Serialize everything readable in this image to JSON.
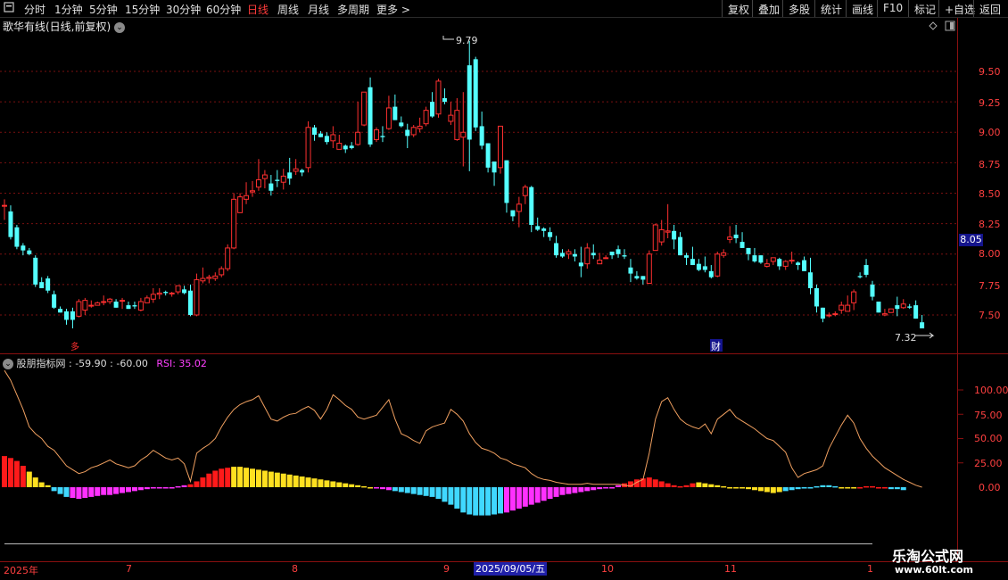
{
  "toolbar": {
    "left_items": [
      "分时",
      "1分钟",
      "5分钟",
      "15分钟",
      "30分钟",
      "60分钟",
      "日线",
      "周线",
      "月线",
      "多周期",
      "更多 >"
    ],
    "active_index": 6,
    "right_items": [
      "复权",
      "叠加",
      "多股",
      "统计",
      "画线",
      "F10",
      "标记",
      "+自选",
      "返回"
    ]
  },
  "stock": {
    "title": "歌华有线(日线,前复权)"
  },
  "price_axis": {
    "ticks": [
      "9.50",
      "9.25",
      "9.00",
      "8.75",
      "8.50",
      "8.25",
      "8.00",
      "7.75",
      "7.50"
    ],
    "current_price": "8.05",
    "high_label": "9.79",
    "low_label": "7.32"
  },
  "markers": {
    "event_left": "多",
    "event_finance": "财"
  },
  "indicator": {
    "name": "股朋指标网",
    "v1": ": -59.90",
    "v2": ": -60.00",
    "rsi": "RSI: 35.02",
    "ticks": [
      "100.00",
      "75.00",
      "50.00",
      "25.00",
      "0.00"
    ]
  },
  "dates": {
    "labels": [
      "2025年",
      "7",
      "8",
      "9",
      "10",
      "11",
      "1"
    ],
    "highlight": "2025/09/05/五"
  },
  "watermark": {
    "title": "乐淘公式网",
    "url": "www.60lt.com"
  },
  "colors": {
    "up": "#ff3030",
    "down": "#54ffff",
    "rsi_line": "#f0a060",
    "grid": "#7a1010"
  },
  "candles": [
    [
      8.4,
      8.45,
      8.28,
      8.4
    ],
    [
      8.35,
      8.4,
      8.12,
      8.14
    ],
    [
      8.22,
      8.24,
      8.04,
      8.06
    ],
    [
      8.07,
      8.09,
      7.99,
      8.03
    ],
    [
      8.03,
      8.05,
      7.99,
      8.0
    ],
    [
      7.97,
      7.99,
      7.73,
      7.75
    ],
    [
      7.77,
      7.81,
      7.72,
      7.72
    ],
    [
      7.8,
      7.82,
      7.68,
      7.7
    ],
    [
      7.67,
      7.7,
      7.55,
      7.56
    ],
    [
      7.55,
      7.57,
      7.52,
      7.52
    ],
    [
      7.53,
      7.55,
      7.42,
      7.46
    ],
    [
      7.53,
      7.56,
      7.39,
      7.46
    ],
    [
      7.49,
      7.63,
      7.48,
      7.61
    ],
    [
      7.54,
      7.64,
      7.5,
      7.62
    ],
    [
      7.58,
      7.62,
      7.56,
      7.58
    ],
    [
      7.58,
      7.61,
      7.58,
      7.6
    ],
    [
      7.61,
      7.66,
      7.58,
      7.61
    ],
    [
      7.61,
      7.64,
      7.59,
      7.63
    ],
    [
      7.61,
      7.63,
      7.56,
      7.56
    ],
    [
      7.62,
      7.64,
      7.55,
      7.62
    ],
    [
      7.58,
      7.61,
      7.55,
      7.55
    ],
    [
      7.58,
      7.61,
      7.55,
      7.57
    ],
    [
      7.54,
      7.64,
      7.53,
      7.61
    ],
    [
      7.6,
      7.66,
      7.6,
      7.64
    ],
    [
      7.63,
      7.72,
      7.6,
      7.67
    ],
    [
      7.67,
      7.72,
      7.63,
      7.68
    ],
    [
      7.69,
      7.7,
      7.66,
      7.68
    ],
    [
      7.68,
      7.69,
      7.65,
      7.68
    ],
    [
      7.69,
      7.74,
      7.67,
      7.74
    ],
    [
      7.71,
      7.74,
      7.67,
      7.68
    ],
    [
      7.7,
      7.75,
      7.49,
      7.5
    ],
    [
      7.5,
      7.84,
      7.49,
      7.79
    ],
    [
      7.78,
      7.89,
      7.76,
      7.8
    ],
    [
      7.8,
      7.83,
      7.76,
      7.81
    ],
    [
      7.8,
      7.85,
      7.78,
      7.82
    ],
    [
      7.83,
      7.9,
      7.81,
      7.88
    ],
    [
      7.88,
      8.08,
      7.86,
      8.05
    ],
    [
      8.05,
      8.5,
      8.04,
      8.45
    ],
    [
      8.34,
      8.5,
      8.34,
      8.47
    ],
    [
      8.45,
      8.59,
      8.41,
      8.48
    ],
    [
      8.51,
      8.6,
      8.47,
      8.52
    ],
    [
      8.55,
      8.78,
      8.52,
      8.61
    ],
    [
      8.62,
      8.69,
      8.54,
      8.65
    ],
    [
      8.58,
      8.65,
      8.48,
      8.52
    ],
    [
      8.61,
      8.69,
      8.55,
      8.6
    ],
    [
      8.59,
      8.7,
      8.53,
      8.64
    ],
    [
      8.67,
      8.79,
      8.57,
      8.62
    ],
    [
      8.68,
      8.78,
      8.65,
      8.7
    ],
    [
      8.69,
      8.7,
      8.64,
      8.67
    ],
    [
      8.71,
      9.09,
      8.67,
      9.04
    ],
    [
      9.04,
      9.06,
      8.93,
      8.98
    ],
    [
      8.99,
      9.01,
      8.96,
      8.96
    ],
    [
      8.97,
      9.0,
      8.9,
      8.92
    ],
    [
      8.93,
      9.05,
      8.87,
      8.98
    ],
    [
      8.86,
      8.98,
      8.86,
      8.91
    ],
    [
      8.89,
      8.9,
      8.83,
      8.86
    ],
    [
      8.89,
      8.92,
      8.86,
      8.87
    ],
    [
      8.9,
      9.25,
      8.89,
      9.0
    ],
    [
      9.06,
      9.32,
      9.05,
      9.33
    ],
    [
      9.37,
      9.45,
      8.88,
      8.9
    ],
    [
      8.94,
      9.04,
      8.92,
      9.02
    ],
    [
      8.97,
      9.05,
      8.92,
      8.96
    ],
    [
      9.03,
      9.3,
      9.02,
      9.2
    ],
    [
      9.21,
      9.31,
      9.15,
      9.1
    ],
    [
      9.08,
      9.13,
      9.04,
      9.05
    ],
    [
      9.02,
      9.07,
      8.87,
      8.97
    ],
    [
      8.98,
      9.06,
      8.96,
      9.04
    ],
    [
      9.03,
      9.12,
      9.0,
      9.05
    ],
    [
      9.07,
      9.21,
      9.05,
      9.18
    ],
    [
      9.25,
      9.33,
      9.12,
      9.13
    ],
    [
      9.15,
      9.44,
      9.12,
      9.42
    ],
    [
      9.28,
      9.36,
      9.23,
      9.25
    ],
    [
      9.09,
      9.25,
      9.06,
      9.14
    ],
    [
      8.94,
      9.28,
      8.93,
      9.18
    ],
    [
      8.96,
      9.33,
      8.72,
      9.0
    ],
    [
      9.55,
      9.75,
      8.68,
      8.94
    ],
    [
      9.6,
      9.62,
      9.01,
      9.04
    ],
    [
      9.05,
      9.17,
      8.86,
      8.89
    ],
    [
      8.91,
      8.9,
      8.67,
      8.71
    ],
    [
      8.76,
      8.73,
      8.56,
      8.67
    ],
    [
      8.71,
      9.05,
      8.66,
      9.05
    ],
    [
      8.77,
      8.74,
      8.34,
      8.42
    ],
    [
      8.36,
      8.33,
      8.27,
      8.31
    ],
    [
      8.35,
      8.47,
      8.22,
      8.41
    ],
    [
      8.48,
      8.57,
      8.41,
      8.55
    ],
    [
      8.55,
      8.56,
      8.18,
      8.24
    ],
    [
      8.23,
      8.3,
      8.19,
      8.2
    ],
    [
      8.21,
      8.22,
      8.14,
      8.19
    ],
    [
      8.18,
      8.22,
      8.11,
      8.14
    ],
    [
      8.09,
      8.15,
      7.97,
      7.99
    ],
    [
      8.01,
      8.04,
      7.97,
      7.98
    ],
    [
      8.0,
      8.04,
      7.96,
      8.02
    ],
    [
      8.0,
      8.04,
      7.94,
      7.98
    ],
    [
      7.93,
      8.06,
      7.81,
      7.9
    ],
    [
      7.92,
      8.09,
      7.88,
      8.05
    ],
    [
      8.01,
      8.08,
      7.96,
      7.99
    ],
    [
      7.92,
      8.01,
      7.93,
      7.95
    ],
    [
      7.97,
      7.99,
      7.96,
      7.97
    ],
    [
      8.02,
      8.0,
      7.96,
      7.99
    ],
    [
      8.04,
      8.07,
      7.97,
      8.0
    ],
    [
      7.99,
      8.04,
      7.96,
      7.98
    ],
    [
      7.89,
      7.96,
      7.77,
      7.84
    ],
    [
      7.82,
      7.86,
      7.79,
      7.8
    ],
    [
      7.82,
      7.82,
      7.75,
      7.79
    ],
    [
      7.76,
      8.03,
      7.81,
      8.0
    ],
    [
      8.03,
      8.25,
      8.06,
      8.24
    ],
    [
      8.1,
      8.28,
      8.07,
      8.2
    ],
    [
      8.18,
      8.41,
      8.13,
      8.19
    ],
    [
      8.19,
      8.24,
      8.04,
      8.12
    ],
    [
      8.14,
      8.18,
      7.99,
      7.99
    ],
    [
      7.99,
      8.01,
      7.91,
      7.97
    ],
    [
      7.96,
      8.06,
      7.93,
      7.91
    ],
    [
      7.92,
      7.96,
      7.86,
      7.87
    ],
    [
      7.9,
      7.98,
      7.85,
      7.87
    ],
    [
      7.86,
      7.91,
      7.8,
      7.81
    ],
    [
      7.82,
      8.02,
      7.81,
      8.0
    ],
    [
      7.99,
      8.04,
      7.97,
      8.01
    ],
    [
      8.12,
      8.23,
      8.09,
      8.14
    ],
    [
      8.16,
      8.24,
      8.09,
      8.13
    ],
    [
      8.1,
      8.18,
      8.05,
      8.05
    ],
    [
      8.05,
      8.01,
      7.95,
      8.0
    ],
    [
      7.99,
      8.05,
      7.93,
      7.94
    ],
    [
      7.99,
      7.99,
      7.92,
      7.93
    ],
    [
      7.9,
      7.96,
      7.89,
      7.92
    ],
    [
      7.94,
      7.97,
      7.91,
      7.97
    ],
    [
      7.96,
      7.97,
      7.87,
      7.9
    ],
    [
      7.9,
      7.95,
      7.87,
      7.94
    ],
    [
      7.95,
      8.02,
      7.92,
      7.95
    ],
    [
      7.93,
      7.94,
      7.87,
      7.91
    ],
    [
      7.95,
      7.98,
      7.86,
      7.86
    ],
    [
      7.85,
      7.97,
      7.67,
      7.72
    ],
    [
      7.72,
      7.75,
      7.52,
      7.57
    ],
    [
      7.56,
      7.56,
      7.44,
      7.47
    ],
    [
      7.5,
      7.52,
      7.48,
      7.5
    ],
    [
      7.51,
      7.53,
      7.49,
      7.51
    ],
    [
      7.54,
      7.61,
      7.51,
      7.58
    ],
    [
      7.53,
      7.66,
      7.53,
      7.58
    ],
    [
      7.6,
      7.71,
      7.54,
      7.69
    ],
    [
      7.82,
      7.85,
      7.8,
      7.81
    ],
    [
      7.91,
      7.96,
      7.81,
      7.83
    ],
    [
      7.75,
      7.78,
      7.62,
      7.65
    ],
    [
      7.61,
      7.61,
      7.52,
      7.52
    ],
    [
      7.5,
      7.55,
      7.49,
      7.51
    ],
    [
      7.52,
      7.55,
      7.52,
      7.55
    ],
    [
      7.58,
      7.65,
      7.49,
      7.55
    ],
    [
      7.56,
      7.63,
      7.55,
      7.59
    ],
    [
      7.57,
      7.59,
      7.55,
      7.56
    ],
    [
      7.58,
      7.62,
      7.49,
      7.47
    ],
    [
      7.44,
      7.5,
      7.39,
      7.39
    ]
  ],
  "hist": [
    32,
    30,
    27,
    22,
    16,
    10,
    5,
    2,
    -4,
    -7,
    -10,
    -11,
    -12,
    -11,
    -10,
    -9,
    -8,
    -8,
    -7,
    -6,
    -5,
    -4,
    -3,
    -2,
    -1,
    0,
    0,
    0,
    1,
    2,
    3,
    6,
    10,
    14,
    17,
    19,
    20,
    21,
    21,
    20,
    19,
    18,
    17,
    16,
    15,
    14,
    13,
    12,
    11,
    10,
    9,
    8,
    7,
    6,
    5,
    4,
    3,
    2,
    1,
    0,
    -1,
    -2,
    -3,
    -4,
    -5,
    -6,
    -7,
    -8,
    -9,
    -10,
    -12,
    -15,
    -18,
    -22,
    -26,
    -28,
    -29,
    -29,
    -29,
    -28,
    -27,
    -26,
    -24,
    -22,
    -20,
    -18,
    -16,
    -14,
    -12,
    -10,
    -8,
    -7,
    -6,
    -5,
    -4,
    -3,
    -2,
    -1,
    0,
    2,
    4,
    6,
    8,
    9,
    10,
    8,
    6,
    4,
    2,
    1,
    2,
    4,
    5,
    4,
    3,
    2,
    1,
    0,
    0,
    -1,
    -2,
    -3,
    -4,
    -5,
    -6,
    -5,
    -4,
    -3,
    -2,
    -1,
    0,
    1,
    2,
    2,
    1,
    0,
    -1,
    -1,
    0,
    1,
    1,
    0,
    -1,
    -2,
    -2,
    -3
  ],
  "hist_colors": "rrrryyyycccmmmmmmmmmmmmmmmmmmmrrrrrrryyyyyyyyyyyyyyyyyyyyyyymmmccccccccccccccccccmmmmmmmmmmmmmmmmmmmrrrrrrrrrrrryyyyyyyyyyyyyycccccccccyyyrrrrrccccrrr",
  "rsi": [
    120,
    110,
    95,
    80,
    62,
    55,
    50,
    42,
    38,
    30,
    22,
    18,
    14,
    16,
    20,
    22,
    25,
    28,
    24,
    22,
    20,
    22,
    28,
    32,
    38,
    34,
    30,
    28,
    30,
    24,
    6,
    35,
    40,
    44,
    50,
    62,
    72,
    80,
    85,
    88,
    90,
    94,
    82,
    70,
    68,
    72,
    75,
    76,
    80,
    83,
    79,
    70,
    80,
    95,
    90,
    84,
    80,
    72,
    70,
    72,
    74,
    82,
    90,
    70,
    55,
    52,
    48,
    45,
    58,
    62,
    64,
    66,
    80,
    75,
    68,
    55,
    46,
    40,
    38,
    35,
    30,
    28,
    24,
    22,
    20,
    14,
    10,
    8,
    7,
    5,
    4,
    3,
    3,
    3,
    4,
    3,
    3,
    3,
    3,
    3,
    2,
    1,
    5,
    8,
    35,
    70,
    88,
    92,
    80,
    70,
    65,
    62,
    60,
    65,
    55,
    70,
    75,
    80,
    72,
    68,
    64,
    60,
    55,
    50,
    48,
    42,
    36,
    20,
    10,
    14,
    16,
    18,
    22,
    40,
    52,
    64,
    74,
    66,
    50,
    40,
    32,
    26,
    20,
    16,
    12,
    8,
    5,
    2,
    0
  ]
}
